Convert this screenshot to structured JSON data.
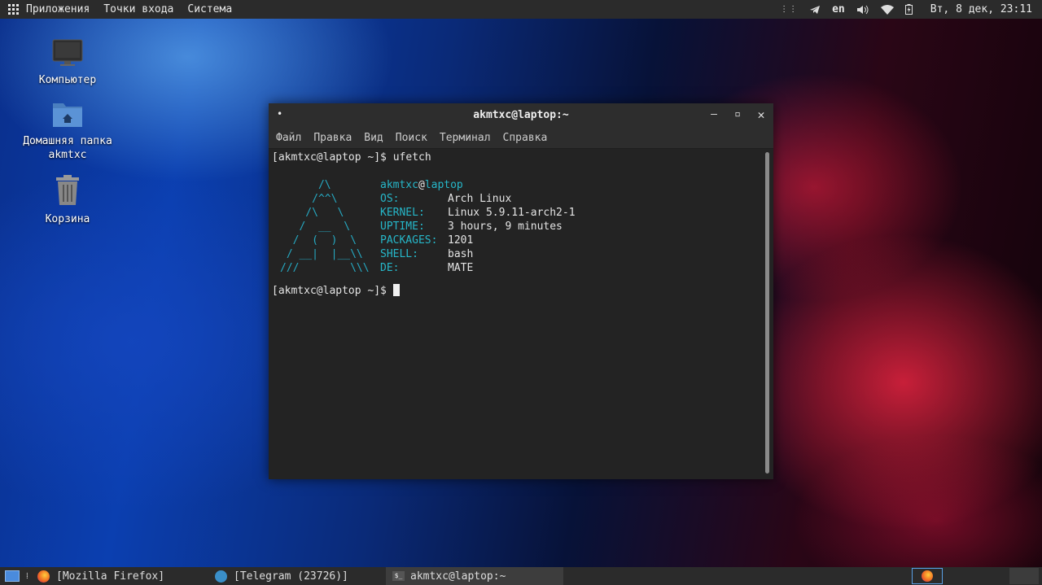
{
  "topbar": {
    "menus": [
      "Приложения",
      "Точки входа",
      "Система"
    ],
    "keyboard_layout": "en",
    "clock": "Вт,  8 дек, 23:11"
  },
  "desktop": {
    "icons": [
      {
        "label": "Компьютер",
        "icon": "computer-icon"
      },
      {
        "label": "Домашняя папка akmtxc",
        "icon": "home-folder-icon"
      },
      {
        "label": "Корзина",
        "icon": "trash-icon"
      }
    ]
  },
  "terminal": {
    "title": "akmtxc@laptop:~",
    "menu": [
      "Файл",
      "Правка",
      "Вид",
      "Поиск",
      "Терминал",
      "Справка"
    ],
    "prompt": "[akmtxc@laptop ~]$ ",
    "command": "ufetch",
    "ascii_art": "      /\\\n     /^^\\\n    /\\   \\\n   /  __  \\\n  /  (  )  \\\n / __|  |__\\\\\n///        \\\\\\",
    "user": "akmtxc",
    "at": "@",
    "host": "laptop",
    "info": [
      {
        "key": "OS:",
        "value": "Arch Linux"
      },
      {
        "key": "KERNEL:",
        "value": "Linux 5.9.11-arch2-1"
      },
      {
        "key": "UPTIME:",
        "value": "3 hours, 9 minutes"
      },
      {
        "key": "PACKAGES:",
        "value": "1201"
      },
      {
        "key": "SHELL:",
        "value": "bash"
      },
      {
        "key": "DE:",
        "value": "MATE"
      }
    ]
  },
  "taskbar": {
    "items": [
      {
        "label": "[Mozilla Firefox]",
        "icon": "firefox-icon"
      },
      {
        "label": "[Telegram (23726)]",
        "icon": "telegram-icon"
      },
      {
        "label": "akmtxc@laptop:~",
        "icon": "terminal-icon"
      }
    ]
  },
  "colors": {
    "accent": "#26b7c9",
    "panel": "#2b2b2b",
    "terminal_bg": "#232323"
  }
}
